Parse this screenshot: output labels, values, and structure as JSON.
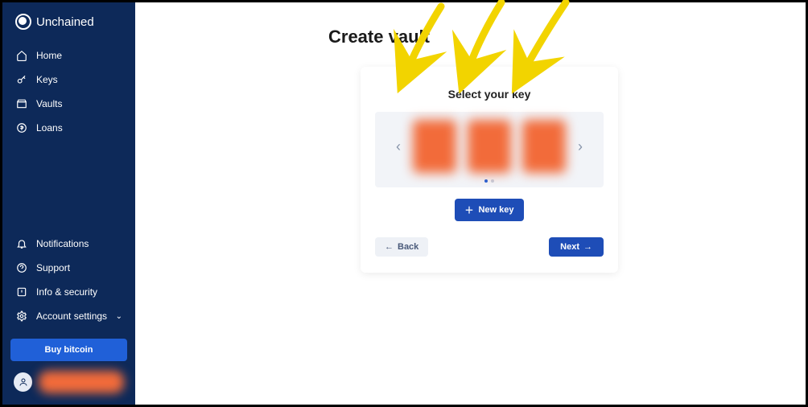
{
  "brand": {
    "name": "Unchained"
  },
  "sidebar": {
    "top": [
      {
        "label": "Home"
      },
      {
        "label": "Keys"
      },
      {
        "label": "Vaults"
      },
      {
        "label": "Loans"
      }
    ],
    "bottom": [
      {
        "label": "Notifications"
      },
      {
        "label": "Support"
      },
      {
        "label": "Info & security"
      },
      {
        "label": "Account settings"
      }
    ],
    "buy_label": "Buy bitcoin"
  },
  "page": {
    "title": "Create vault",
    "card_title": "Select your key",
    "new_key_label": "New key",
    "back_label": "Back",
    "next_label": "Next",
    "carousel_prev": "‹",
    "carousel_next": "›"
  }
}
